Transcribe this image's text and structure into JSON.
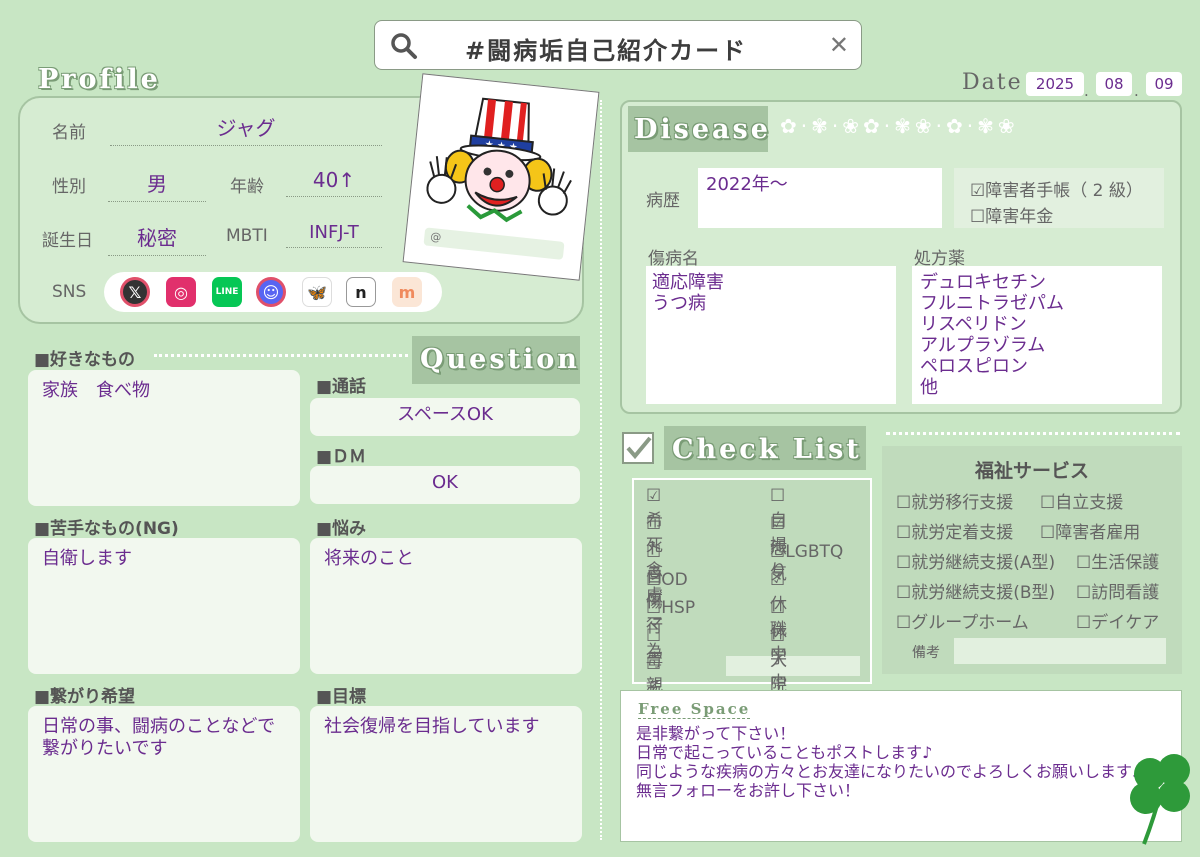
{
  "search": {
    "text": "#闘病垢自己紹介カード"
  },
  "date": {
    "label": "Date",
    "year": "2025",
    "month": "08",
    "day": "09"
  },
  "profile": {
    "title": "Profile",
    "name_label": "名前",
    "name": "ジャグ",
    "gender_label": "性別",
    "gender": "男",
    "age_label": "年齢",
    "age": "40↑",
    "birthday_label": "誕生日",
    "birthday": "秘密",
    "mbti_label": "MBTI",
    "mbti": "INFJ-T",
    "sns_label": "SNS",
    "photo_at": "@"
  },
  "question": {
    "title": "Question",
    "likes_label": "■好きなもの",
    "likes": "家族　食べ物",
    "call_label": "■通話",
    "call": "スペースOK",
    "dm_label": "■ＤＭ",
    "dm": "OK",
    "dislikes_label": "■苦手なもの(NG)",
    "dislikes": "自衛します",
    "worries_label": "■悩み",
    "worries": "将来のこと",
    "connect_label": "■繋がり希望",
    "connect": "日常の事、闘病のことなどで繋がりたいです",
    "goal_label": "■目標",
    "goal": "社会復帰を目指しています"
  },
  "disease": {
    "title": "Disease",
    "history_label": "病歴",
    "history": "2022年～",
    "handbook": "☑障害者手帳（ 2 級）",
    "pension": "☐障害年金",
    "diagnosis_label": "傷病名",
    "diagnosis": [
      "適応障害",
      "うつ病"
    ],
    "meds_label": "処方薬",
    "meds": [
      "デュロキセチン",
      "フルニトラゼパム",
      "リスペリドン",
      "アルプラゾラム",
      "ペロスピロン",
      "他"
    ]
  },
  "checklist": {
    "title": "Check List",
    "left": [
      "☑希死念慮",
      "☐トラウマ",
      "☐自傷行為",
      "☐OD",
      "☐HSP",
      "☐毒親育ち",
      "☐その他"
    ],
    "right": [
      "☐自撮り",
      "☑怨気",
      "☐LGBTQ",
      "☑休職中",
      "☐休学中",
      "☐入院中"
    ]
  },
  "welfare": {
    "title": "福祉サービス",
    "left": [
      "☐就労移行支援",
      "☐就労定着支援",
      "☐就労継続支援(A型)",
      "☐就労継続支援(B型)",
      "☐グループホーム"
    ],
    "right": [
      "☐自立支援",
      "☐障害者雇用",
      "☐生活保護",
      "☐訪問看護",
      "☐デイケア"
    ],
    "note_label": "備考"
  },
  "free": {
    "title": "Free Space",
    "lines": [
      "是非繋がって下さい！",
      "日常で起こっていることもポストします♪",
      "同じような疾病の方々とお友達になりたいのでよろしくお願いします♪",
      "無言フォローをお許し下さい！"
    ]
  },
  "colors": {
    "bg": "#c8e6c4",
    "panel": "#d6ecd2",
    "accent": "#6b2c8f",
    "tab": "#a6c4a2"
  }
}
